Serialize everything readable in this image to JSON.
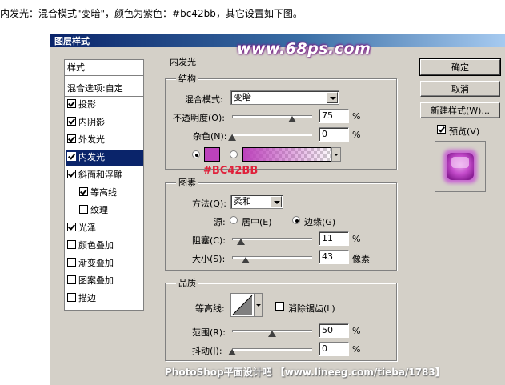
{
  "instruction": "内发光：混合模式\"变暗\"，颜色为紫色：#bc42bb，其它设置如下图。",
  "window": {
    "title": "图层样式"
  },
  "watermark_top": "www.68ps.com",
  "watermark_bottom": "PhotoShop平面设计吧 【www.lineeg.com/tieba/1783】",
  "sidebar": {
    "header": "样式",
    "blend_options": "混合选项:自定",
    "items": [
      {
        "label": "投影",
        "checked": true,
        "selected": false,
        "indent": false
      },
      {
        "label": "内阴影",
        "checked": true,
        "selected": false,
        "indent": false
      },
      {
        "label": "外发光",
        "checked": true,
        "selected": false,
        "indent": false
      },
      {
        "label": "内发光",
        "checked": true,
        "selected": true,
        "indent": false
      },
      {
        "label": "斜面和浮雕",
        "checked": true,
        "selected": false,
        "indent": false
      },
      {
        "label": "等高线",
        "checked": true,
        "selected": false,
        "indent": true
      },
      {
        "label": "纹理",
        "checked": false,
        "selected": false,
        "indent": true
      },
      {
        "label": "光泽",
        "checked": true,
        "selected": false,
        "indent": false
      },
      {
        "label": "颜色叠加",
        "checked": false,
        "selected": false,
        "indent": false
      },
      {
        "label": "渐变叠加",
        "checked": false,
        "selected": false,
        "indent": false
      },
      {
        "label": "图案叠加",
        "checked": false,
        "selected": false,
        "indent": false
      },
      {
        "label": "描边",
        "checked": false,
        "selected": false,
        "indent": false
      }
    ]
  },
  "panel": {
    "title": "内发光",
    "structure": {
      "legend": "结构",
      "blend_mode_label": "混合模式:",
      "blend_mode_value": "变暗",
      "opacity_label": "不透明度(O):",
      "opacity_value": "75",
      "opacity_unit": "%",
      "opacity_level": 0.75,
      "noise_label": "杂色(N):",
      "noise_value": "0",
      "noise_unit": "%",
      "noise_level": 0.0,
      "glow_color": "#bc42bb",
      "color_annotation": "#BC42BB"
    },
    "elements": {
      "legend": "图素",
      "method_label": "方法(Q):",
      "method_value": "柔和",
      "source_label": "源:",
      "source_center": "居中(E)",
      "source_edge": "边缘(G)",
      "source_selected": "edge",
      "choke_label": "阻塞(C):",
      "choke_value": "11",
      "choke_unit": "%",
      "choke_level": 0.11,
      "size_label": "大小(S):",
      "size_value": "43",
      "size_unit": "像素",
      "size_level": 0.17
    },
    "quality": {
      "legend": "品质",
      "contour_label": "等高线:",
      "antialias_label": "消除锯齿(L)",
      "antialias_checked": false,
      "range_label": "范围(R):",
      "range_value": "50",
      "range_unit": "%",
      "range_level": 0.5,
      "jitter_label": "抖动(J):",
      "jitter_value": "0",
      "jitter_unit": "%",
      "jitter_level": 0.0
    }
  },
  "buttons": {
    "ok": "确定",
    "cancel": "取消",
    "new_style": "新建样式(W)...",
    "preview_label": "预览(V)",
    "preview_checked": true
  }
}
